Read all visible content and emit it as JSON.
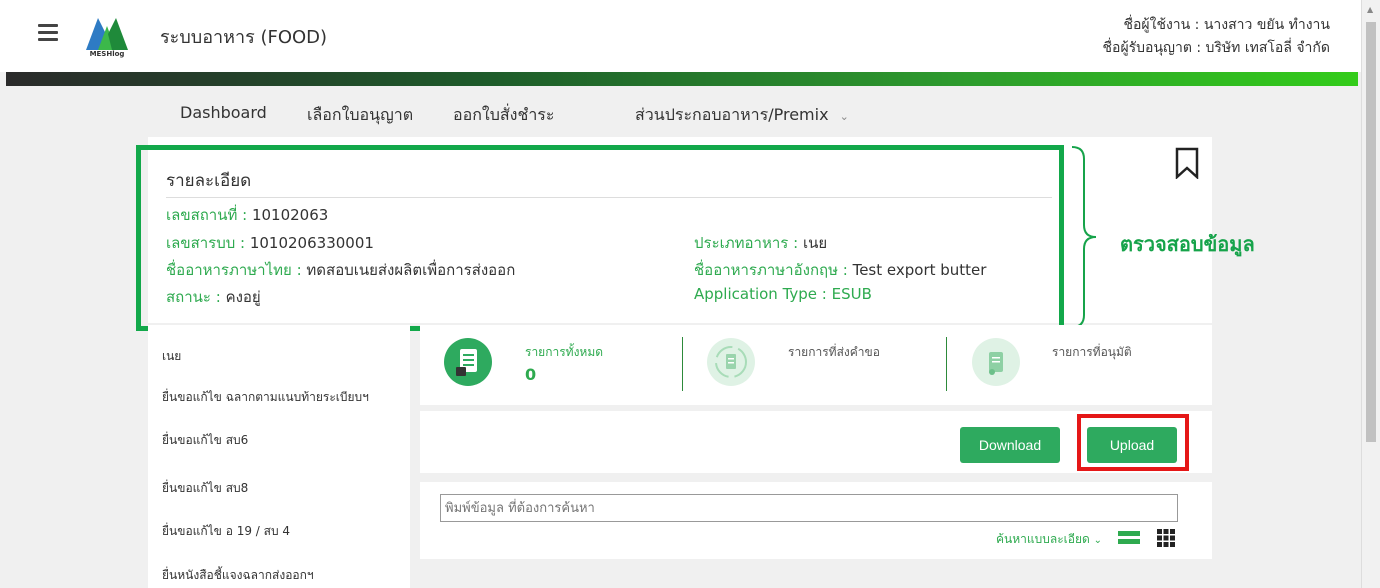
{
  "header": {
    "app_title": "ระบบอาหาร (FOOD)",
    "logo_text": "MESHlog",
    "user_line": "ชื่อผู้ใช้งาน : นางสาว ขยัน ทำงาน",
    "licensee_line": "ชื่อผู้รับอนุญาต : บริษัท เทสโอลี่ จำกัด"
  },
  "nav": {
    "items": [
      "Dashboard",
      "เลือกใบอนุญาต",
      "ออกใบสั่งชำระ",
      "ส่วนประกอบอาหาร/Premix"
    ]
  },
  "detail": {
    "title": "รายละเอียด",
    "place_label": "เลขสถานที่ : ",
    "place_value": "10102063",
    "reg_label": "เลขสารบบ : ",
    "reg_value": "1010206330001",
    "thai_name_label": "ชื่ออาหารภาษาไทย : ",
    "thai_name_value": "ทดสอบเนยส่งผลิตเพื่อการส่งออก",
    "status_label": "สถานะ : ",
    "status_value": "คงอยู่",
    "food_type_label": "ประเภทอาหาร : ",
    "food_type_value": "เนย",
    "eng_name_label": "ชื่ออาหารภาษาอังกฤษ : ",
    "eng_name_value": "Test export butter",
    "app_type_label": "Application Type : ",
    "app_type_value": "ESUB"
  },
  "annotation": {
    "text": "ตรวจสอบข้อมูล"
  },
  "sidebar": {
    "items": [
      "เนย",
      "ยื่นขอแก้ไข ฉลากตามแนบท้ายระเบียบฯ",
      "ยื่นขอแก้ไข สบ6",
      "ยื่นขอแก้ไข สบ8",
      "ยื่นขอแก้ไข อ 19 / สบ 4",
      "ยื่นหนังสือชี้แจงฉลากส่งออกฯ"
    ]
  },
  "stats": {
    "total_label": "รายการทั้งหมด",
    "total_count": "0",
    "submitted_label": "รายการที่ส่งคำขอ",
    "approved_label": "รายการที่อนุมัติ"
  },
  "actions": {
    "download_label": "Download",
    "upload_label": "Upload"
  },
  "search": {
    "placeholder": "พิมพ์ข้อมูล ที่ต้องการค้นหา",
    "advanced_label": "ค้นหาแบบละเอียด"
  },
  "icons": {
    "menu": "hamburger-menu-icon",
    "bookmark": "bookmark-icon",
    "total": "document-icon",
    "submitted": "refresh-document-icon",
    "approved": "approved-document-icon",
    "list_view": "list-view-icon",
    "grid_view": "grid-view-icon"
  },
  "colors": {
    "accent": "#2eaa4f",
    "highlight_box": "#12a84a",
    "upload_highlight": "#e51717"
  }
}
